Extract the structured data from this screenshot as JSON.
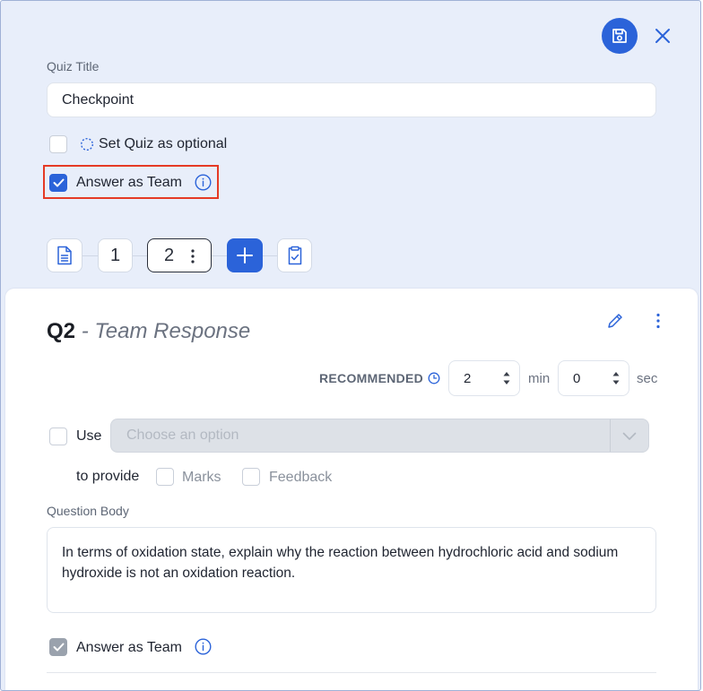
{
  "quiz_title": {
    "label": "Quiz Title",
    "value": "Checkpoint"
  },
  "options": {
    "optional_label": "Set Quiz as optional",
    "optional_checked": false,
    "team_label": "Answer as Team",
    "team_checked": true
  },
  "toolbar": {
    "items": [
      "1",
      "2"
    ]
  },
  "question": {
    "number": "Q2",
    "subtitle": "- Team Response",
    "recommended_label": "RECOMMENDED",
    "minutes": "2",
    "min_unit": "min",
    "seconds": "0",
    "sec_unit": "sec",
    "use_label": "Use",
    "select_placeholder": "Choose an option",
    "provide_label": "to provide",
    "marks_label": "Marks",
    "feedback_label": "Feedback",
    "body_label": "Question Body",
    "body_text": "In terms of oxidation state, explain why the reaction between hydrochloric acid and sodium hydroxide is not an oxidation reaction.",
    "answer_team_label": "Answer as Team"
  },
  "colors": {
    "accent": "#2b63d9",
    "panel_bg": "#e8eefa",
    "highlight": "#e53a25"
  }
}
